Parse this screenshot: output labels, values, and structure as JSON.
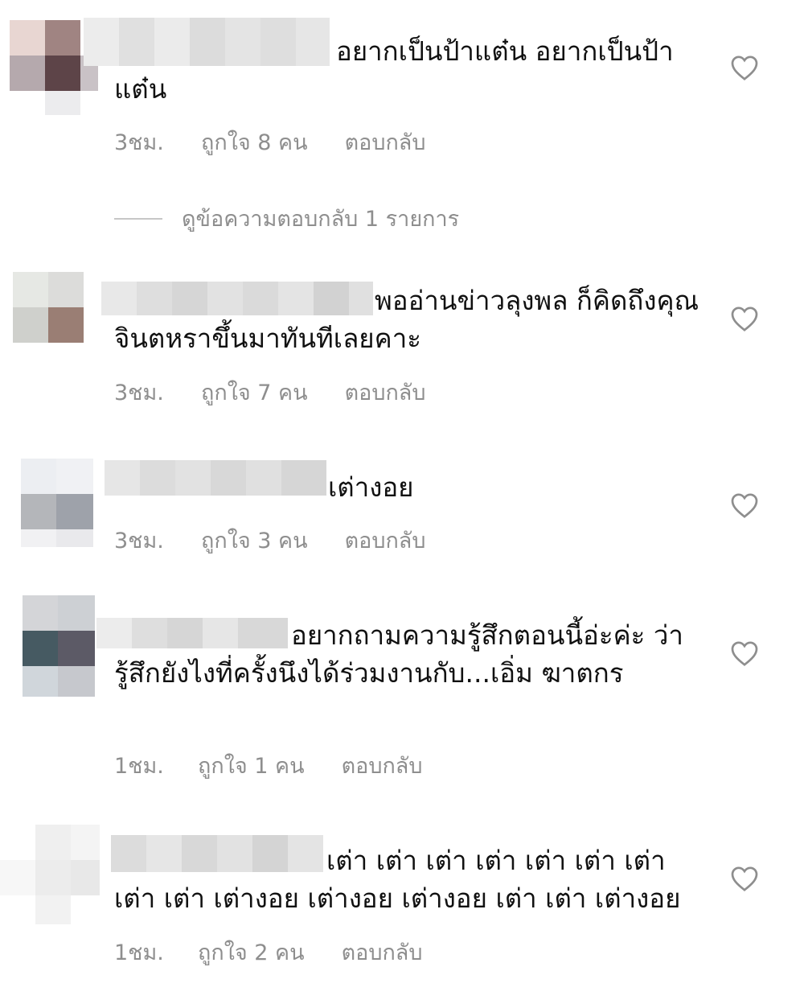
{
  "comments": [
    {
      "text": "อยากเป็นป้าแต๋น อยากเป็นป้าแต๋น",
      "time": "3ชม.",
      "likes": "ถูกใจ 8 คน",
      "reply": "ตอบกลับ",
      "view_replies": "ดูข้อความตอบกลับ 1 รายการ"
    },
    {
      "text": "พออ่านข่าวลุงพล ก็คิดถึงคุณจินตหราขึ้นมาทันทีเลยคาะ",
      "time": "3ชม.",
      "likes": "ถูกใจ 7 คน",
      "reply": "ตอบกลับ"
    },
    {
      "text": "เต่างอย",
      "time": "3ชม.",
      "likes": "ถูกใจ 3 คน",
      "reply": "ตอบกลับ"
    },
    {
      "text": "อยากถามความรู้สึกตอนนี้อ่ะค่ะ ว่ารู้สึกยังไงที่ครั้งนึงได้ร่วมงานกับ...เอิ่ม ฆาตกร",
      "time": "1ชม.",
      "likes": "ถูกใจ 1 คน",
      "reply": "ตอบกลับ"
    },
    {
      "text": "เต่า เต่า เต่า เต่า เต่า เต่า เต่า เต่า เต่า เต่างอย เต่างอย เต่างอย เต่า เต่า เต่างอย",
      "time": "1ชม.",
      "likes": "ถูกใจ 2 คน",
      "reply": "ตอบกลับ"
    }
  ],
  "icons": {
    "like": "heart-outline-icon"
  },
  "colors": {
    "text": "#111111",
    "meta": "#8e8e8e",
    "divider": "#c7c7c7"
  }
}
